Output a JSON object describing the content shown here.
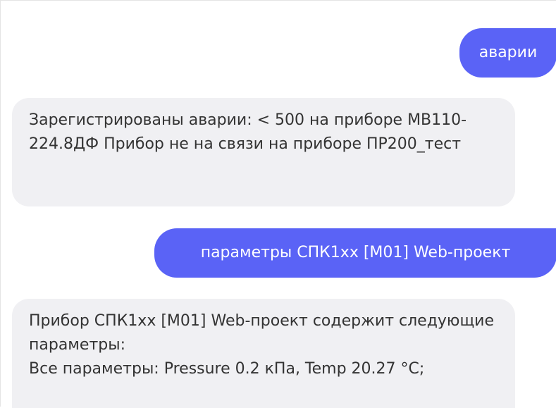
{
  "messages": [
    {
      "role": "user",
      "text": "аварии"
    },
    {
      "role": "bot",
      "text": "Зарегистрированы аварии: < 500 на приборе МВ110-224.8ДФ Прибор не на связи на приборе ПР200_тест"
    },
    {
      "role": "user",
      "text": "параметры СПК1xx [M01] Web-проект"
    },
    {
      "role": "bot",
      "text": "Прибор СПК1xx [M01] Web-проект содержит следующие параметры:\nВсе параметры: Pressure 0.2 кПа, Temp 20.27 °C;"
    }
  ],
  "colors": {
    "user_bubble": "#5a63f6",
    "bot_bubble": "#f0f0f3",
    "bot_text": "#333333"
  }
}
